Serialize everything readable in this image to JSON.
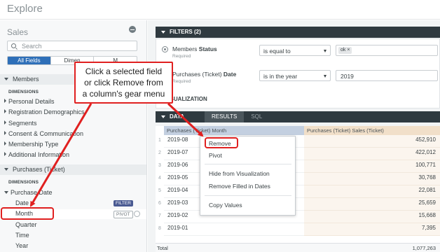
{
  "app": {
    "title": "Explore"
  },
  "sidebar": {
    "model_name": "Sales",
    "search_placeholder": "Search",
    "tabs": [
      {
        "label": "All Fields"
      },
      {
        "label": "Dimen"
      },
      {
        "label": "M"
      }
    ],
    "members_section": "Members",
    "dimensions_heading": "DIMENSIONS",
    "members_items": [
      {
        "label": "Personal Details"
      },
      {
        "label": "Registration Demographics"
      },
      {
        "label": "Segments"
      },
      {
        "label": "Consent & Communication"
      },
      {
        "label": "Membership Type"
      },
      {
        "label": "Additional Information"
      }
    ],
    "purchases_section": "Purchases (Ticket)",
    "purchases_dimensions_heading": "DIMENSIONS",
    "purchase_date_group": "Purchase Date",
    "purchase_date_items": [
      {
        "label": "Date"
      },
      {
        "label": "Month"
      },
      {
        "label": "Quarter"
      },
      {
        "label": "Time"
      },
      {
        "label": "Year"
      }
    ],
    "filter_tag": "FILTER",
    "pivot_tag": "PIVOT"
  },
  "filters": {
    "header": "FILTERS (2)",
    "rows": [
      {
        "label_prefix": "Members ",
        "label_bold": "Status",
        "required": "Required",
        "operator": "is equal to",
        "value": "ok"
      },
      {
        "label_prefix": "Purchases (Ticket) ",
        "label_bold": "Date",
        "required": "Required",
        "operator": "is in the year",
        "value": "2019"
      }
    ]
  },
  "visualization": {
    "label": "VISUALIZATION"
  },
  "data": {
    "header": "DATA",
    "tabs": [
      {
        "label": "RESULTS"
      },
      {
        "label": "SQL"
      }
    ],
    "col1_header": "Purchases (Ticket) Month",
    "col2_header": "Purchases (Ticket) Sales (Ticket)",
    "rows": [
      {
        "num": "1",
        "month": "2019-08",
        "sales": "452,910"
      },
      {
        "num": "2",
        "month": "2019-07",
        "sales": "422,012"
      },
      {
        "num": "3",
        "month": "2019-06",
        "sales": "100,771"
      },
      {
        "num": "4",
        "month": "2019-05",
        "sales": "30,768"
      },
      {
        "num": "5",
        "month": "2019-04",
        "sales": "22,081"
      },
      {
        "num": "6",
        "month": "2019-03",
        "sales": "25,659"
      },
      {
        "num": "7",
        "month": "2019-02",
        "sales": "15,668"
      },
      {
        "num": "8",
        "month": "2019-01",
        "sales": "7,395"
      }
    ],
    "total_label": "Total",
    "total_value": "1,077,263"
  },
  "context_menu": {
    "items": [
      {
        "label": "Remove"
      },
      {
        "label": "Pivot"
      },
      {
        "label": "Hide from Visualization"
      },
      {
        "label": "Remove Filled in Dates"
      },
      {
        "label": "Copy Values"
      }
    ]
  },
  "callout": {
    "lines": [
      "Click a selected field",
      "or click Remove from",
      "a column's gear menu"
    ],
    "color": "#e02020"
  }
}
